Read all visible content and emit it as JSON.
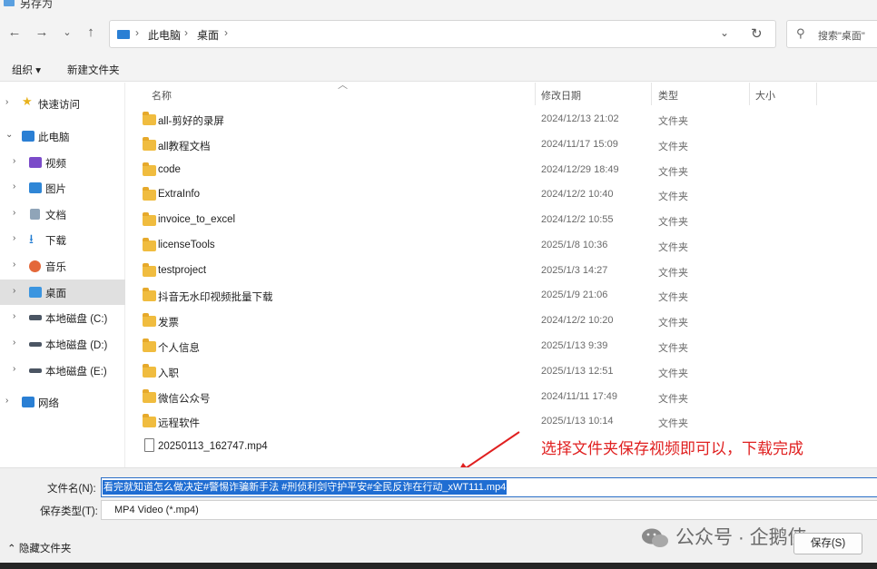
{
  "window": {
    "title": "另存为"
  },
  "nav": {
    "back": "←",
    "forward": "→",
    "recent": "⌄",
    "up": "↑",
    "breadcrumb": [
      "此电脑",
      "桌面"
    ],
    "dropdown": "⌄",
    "refresh": "↻",
    "search_placeholder": "搜索\"桌面\""
  },
  "toolbar": {
    "organize": "组织 ▾",
    "new_folder": "新建文件夹"
  },
  "sidebar": {
    "items": [
      {
        "label": "快速访问",
        "icon": "star-icon",
        "chevron": "›"
      },
      {
        "label": "此电脑",
        "icon": "pc-icon",
        "chevron": "⌄"
      },
      {
        "label": "视频",
        "icon": "video-icon",
        "chevron": "›"
      },
      {
        "label": "图片",
        "icon": "picture-icon",
        "chevron": "›"
      },
      {
        "label": "文档",
        "icon": "document-icon",
        "chevron": "›"
      },
      {
        "label": "下载",
        "icon": "download-icon",
        "chevron": "›"
      },
      {
        "label": "音乐",
        "icon": "music-icon",
        "chevron": "›"
      },
      {
        "label": "桌面",
        "icon": "desktop-icon",
        "chevron": "›",
        "selected": true
      },
      {
        "label": "本地磁盘 (C:)",
        "icon": "drive-c-icon",
        "chevron": "›"
      },
      {
        "label": "本地磁盘 (D:)",
        "icon": "drive-icon",
        "chevron": "›"
      },
      {
        "label": "本地磁盘 (E:)",
        "icon": "drive-icon",
        "chevron": "›"
      },
      {
        "label": "网络",
        "icon": "network-icon",
        "chevron": "›"
      }
    ]
  },
  "columns": {
    "name": "名称",
    "date": "修改日期",
    "type": "类型",
    "size": "大小"
  },
  "files": [
    {
      "name": "all-剪好的录屏",
      "date": "2024/12/13 21:02",
      "type": "文件夹",
      "kind": "folder"
    },
    {
      "name": "all教程文档",
      "date": "2024/11/17 15:09",
      "type": "文件夹",
      "kind": "folder"
    },
    {
      "name": "code",
      "date": "2024/12/29 18:49",
      "type": "文件夹",
      "kind": "folder"
    },
    {
      "name": "ExtraInfo",
      "date": "2024/12/2 10:40",
      "type": "文件夹",
      "kind": "folder"
    },
    {
      "name": "invoice_to_excel",
      "date": "2024/12/2 10:55",
      "type": "文件夹",
      "kind": "folder"
    },
    {
      "name": "licenseTools",
      "date": "2025/1/8 10:36",
      "type": "文件夹",
      "kind": "folder"
    },
    {
      "name": "testproject",
      "date": "2025/1/3 14:27",
      "type": "文件夹",
      "kind": "folder"
    },
    {
      "name": "抖音无水印视频批量下载",
      "date": "2025/1/9 21:06",
      "type": "文件夹",
      "kind": "folder"
    },
    {
      "name": "发票",
      "date": "2024/12/2 10:20",
      "type": "文件夹",
      "kind": "folder"
    },
    {
      "name": "个人信息",
      "date": "2025/1/13 9:39",
      "type": "文件夹",
      "kind": "folder"
    },
    {
      "name": "入职",
      "date": "2025/1/13 12:51",
      "type": "文件夹",
      "kind": "folder"
    },
    {
      "name": "微信公众号",
      "date": "2024/11/11 17:49",
      "type": "文件夹",
      "kind": "folder"
    },
    {
      "name": "远程软件",
      "date": "2025/1/13 10:14",
      "type": "文件夹",
      "kind": "folder"
    },
    {
      "name": "20250113_162747.mp4",
      "date": "",
      "type": "",
      "kind": "video"
    }
  ],
  "annotation": {
    "text": "选择文件夹保存视频即可以，下载完成",
    "color": "#e02020"
  },
  "save": {
    "filename_label": "文件名(N):",
    "filename_value": "看完就知道怎么做决定#警惕诈骗新手法 #刑侦利剑守护平安#全民反诈在行动_xWT111.mp4",
    "filetype_label": "保存类型(T):",
    "filetype_value": "MP4 Video (*.mp4)",
    "hide_folders": "⌃ 隐藏文件夹",
    "save_button": "保存(S)"
  },
  "watermark": {
    "text": "公众号 · 企鹅侠"
  },
  "colors": {
    "accent": "#1f6dd2",
    "folder": "#f0bc3f",
    "selected_bg": "#e0e0e0"
  }
}
